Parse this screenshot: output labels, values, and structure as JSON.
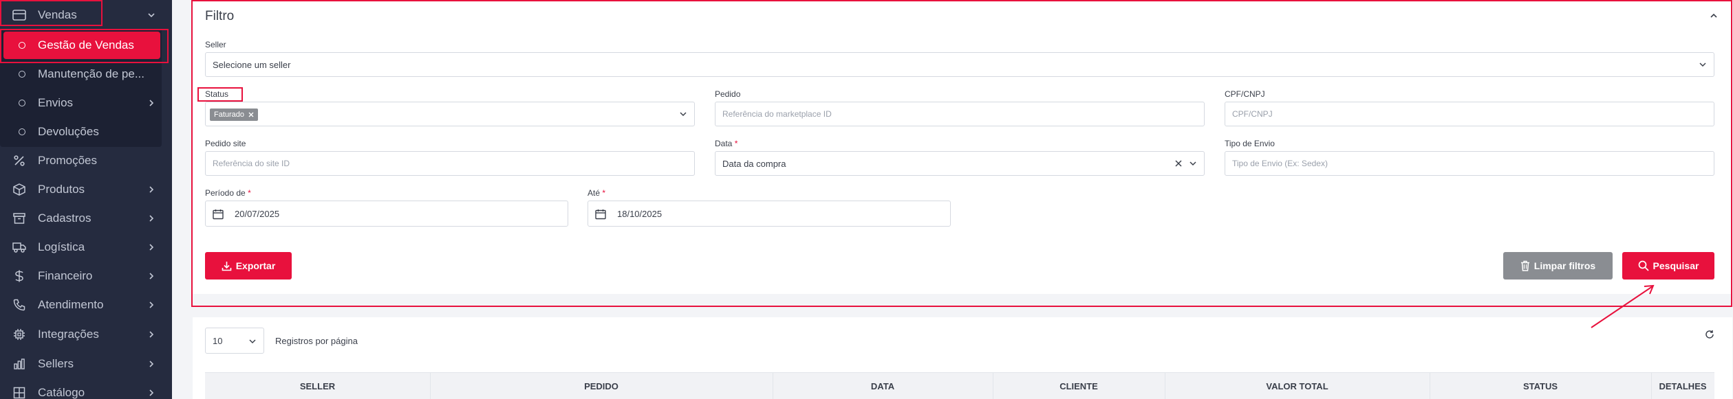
{
  "sidebar": {
    "vendas": "Vendas",
    "submenu": [
      "Gestão de Vendas",
      "Manutenção de pe...",
      "Envios",
      "Devoluções"
    ],
    "items": [
      "Promoções",
      "Produtos",
      "Cadastros",
      "Logística",
      "Financeiro",
      "Atendimento",
      "Integrações",
      "Sellers",
      "Catálogo"
    ]
  },
  "filter": {
    "title": "Filtro",
    "seller_label": "Seller",
    "seller_value": "Selecione um seller",
    "status_label": "Status",
    "status_tag": "Faturado",
    "pedido_label": "Pedido",
    "pedido_placeholder": "Referência do marketplace ID",
    "cpf_label": "CPF/CNPJ",
    "cpf_placeholder": "CPF/CNPJ",
    "pedido_site_label": "Pedido site",
    "pedido_site_placeholder": "Referência do site ID",
    "data_label": "Data",
    "data_value": "Data da compra",
    "tipo_envio_label": "Tipo de Envio",
    "tipo_envio_placeholder": "Tipo de Envio (Ex: Sedex)",
    "periodo_label": "Período de",
    "periodo_value": "20/07/2025",
    "ate_label": "Até",
    "ate_value": "18/10/2025",
    "required_mark": "*",
    "export_label": "Exportar",
    "clear_label": "Limpar filtros",
    "search_label": "Pesquisar"
  },
  "results": {
    "page_size": "10",
    "page_size_label": "Registros por página",
    "columns": [
      "SELLER",
      "PEDIDO",
      "DATA",
      "CLIENTE",
      "VALOR TOTAL",
      "STATUS",
      "DETALHES"
    ]
  },
  "colors": {
    "accent": "#e8113d",
    "sidebar": "#252b3f",
    "gray_button": "#8a8d92"
  }
}
